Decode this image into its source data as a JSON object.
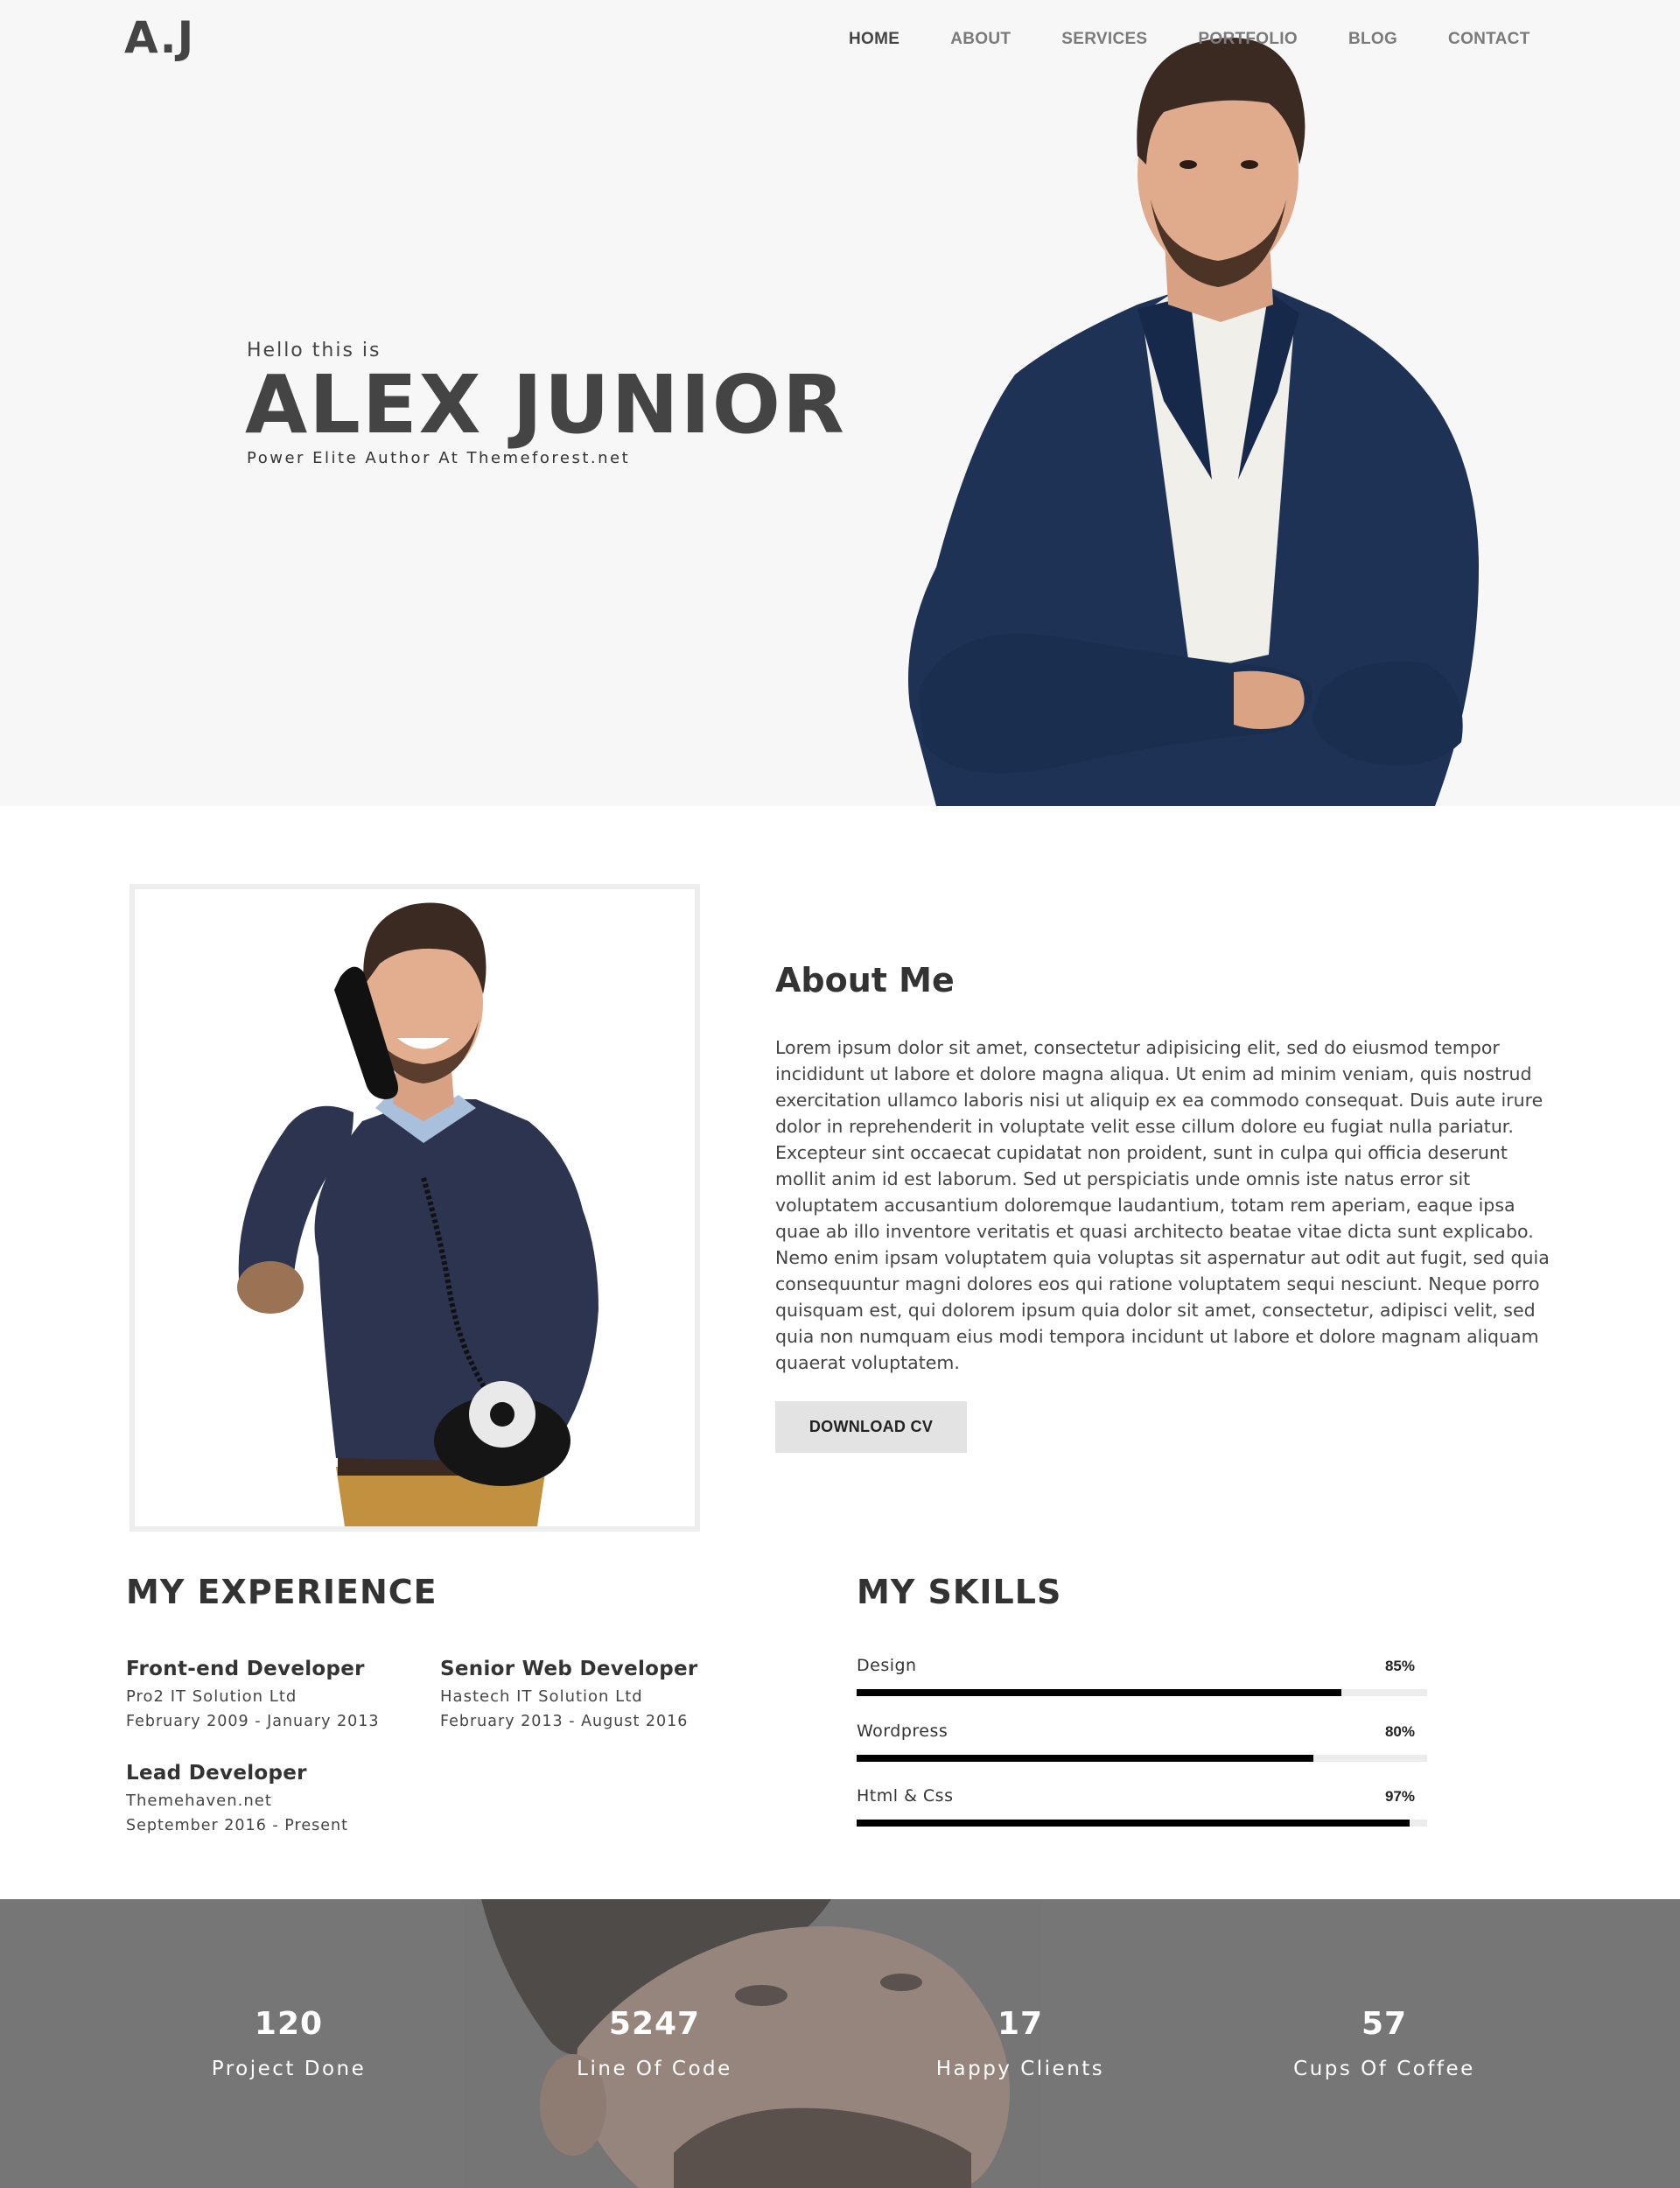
{
  "header": {
    "logo": "A.J",
    "nav": [
      {
        "label": "HOME"
      },
      {
        "label": "ABOUT"
      },
      {
        "label": "SERVICES"
      },
      {
        "label": "PORTFOLIO"
      },
      {
        "label": "BLOG"
      },
      {
        "label": "CONTACT"
      }
    ]
  },
  "hero": {
    "greeting": "Hello this is",
    "name": "ALEX JUNIOR",
    "tagline": "Power Elite Author At Themeforest.net"
  },
  "about": {
    "title": "About Me",
    "paragraph": "Lorem ipsum dolor sit amet, consectetur adipisicing elit, sed do eiusmod tempor incididunt ut labore et dolore magna aliqua. Ut enim ad minim veniam, quis nostrud exercitation ullamco laboris nisi ut aliquip ex ea commodo consequat. Duis aute irure dolor in reprehenderit in voluptate velit esse cillum dolore eu fugiat nulla pariatur. Excepteur sint occaecat cupidatat non proident, sunt in culpa qui officia deserunt mollit anim id est laborum. Sed ut perspiciatis unde omnis iste natus error sit voluptatem accusantium doloremque laudantium, totam rem aperiam, eaque ipsa quae ab illo inventore veritatis et quasi architecto beatae vitae dicta sunt explicabo. Nemo enim ipsam voluptatem quia voluptas sit aspernatur aut odit aut fugit, sed quia consequuntur magni dolores eos qui ratione voluptatem sequi nesciunt. Neque porro quisquam est, qui dolorem ipsum quia dolor sit amet, consectetur, adipisci velit, sed quia non numquam eius modi tempora incidunt ut labore et dolore magnam aliquam quaerat voluptatem.",
    "download_label": "DOWNLOAD CV"
  },
  "experience": {
    "title": "MY EXPERIENCE",
    "items": [
      {
        "role": "Front-end Developer",
        "company": "Pro2 IT Solution Ltd",
        "dates": "February 2009 - January 2013"
      },
      {
        "role": "Senior Web Developer",
        "company": "Hastech IT Solution Ltd",
        "dates": "February 2013 - August 2016"
      },
      {
        "role": "Lead Developer",
        "company": "Themehaven.net",
        "dates": "September 2016 - Present"
      }
    ]
  },
  "skills": {
    "title": "MY SKILLS",
    "items": [
      {
        "name": "Design",
        "percent_label": "85%",
        "level": 0.85
      },
      {
        "name": "Wordpress",
        "percent_label": "80%",
        "level": 0.8
      },
      {
        "name": "Html & Css",
        "percent_label": "97%",
        "level": 0.97
      }
    ]
  },
  "counters": [
    {
      "number": "120",
      "label": "Project Done"
    },
    {
      "number": "5247",
      "label": "Line Of Code"
    },
    {
      "number": "17",
      "label": "Happy Clients"
    },
    {
      "number": "57",
      "label": "Cups Of Coffee"
    }
  ],
  "colors": {
    "hero_bg": "#f7f7f7",
    "text_dark": "#444444",
    "counter_bg": "#767676",
    "skill_fill": "#000000",
    "skill_track": "#ececec",
    "button_bg": "#e3e3e3"
  }
}
